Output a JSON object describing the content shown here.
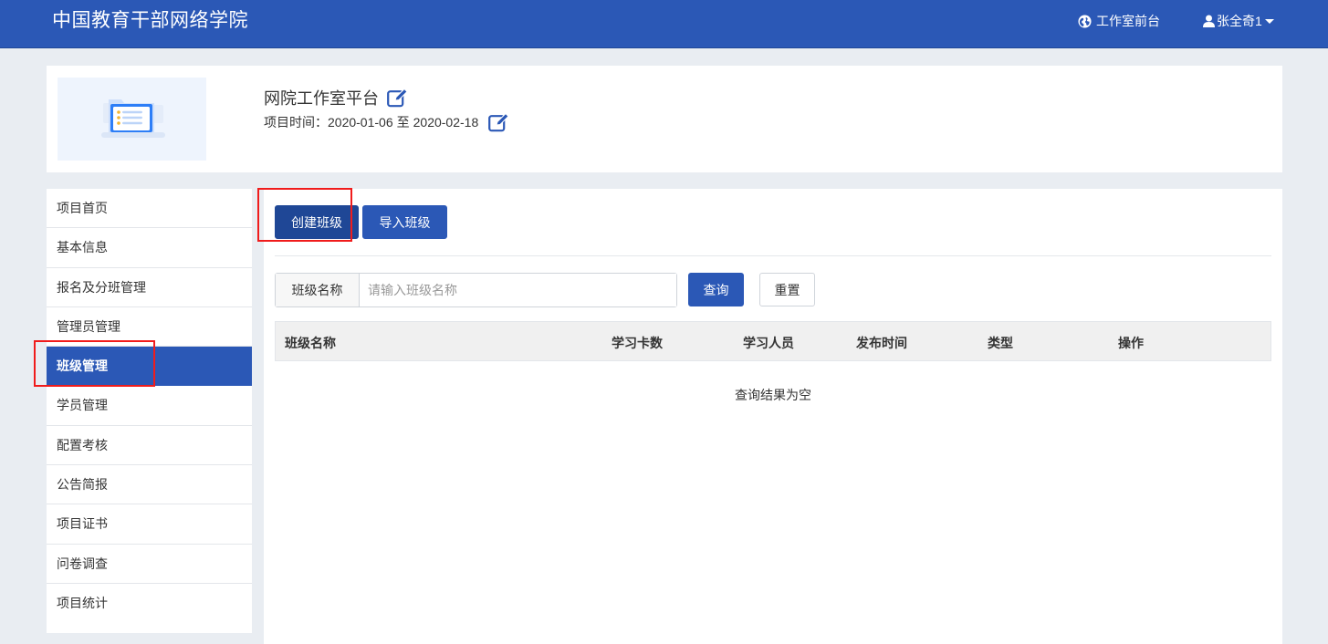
{
  "header": {
    "brand": "中国教育干部网络学院",
    "front_link": "工作室前台",
    "user_name": "张全奇1"
  },
  "project": {
    "title": "网院工作室平台",
    "time_label": "项目时间：",
    "start_date": "2020-01-06",
    "date_separator": "至",
    "end_date": "2020-02-18"
  },
  "sidebar": {
    "items": [
      {
        "label": "项目首页"
      },
      {
        "label": "基本信息"
      },
      {
        "label": "报名及分班管理"
      },
      {
        "label": "管理员管理"
      },
      {
        "label": "班级管理"
      },
      {
        "label": "学员管理"
      },
      {
        "label": "配置考核"
      },
      {
        "label": "公告简报"
      },
      {
        "label": "项目证书"
      },
      {
        "label": "问卷调查"
      },
      {
        "label": "项目统计"
      }
    ],
    "active_index": 4
  },
  "toolbar": {
    "create_label": "创建班级",
    "import_label": "导入班级"
  },
  "search": {
    "label": "班级名称",
    "placeholder": "请输入班级名称",
    "value": "",
    "query_label": "查询",
    "reset_label": "重置"
  },
  "table": {
    "columns": [
      "班级名称",
      "学习卡数",
      "学习人员",
      "发布时间",
      "类型",
      "操作"
    ],
    "rows": [],
    "empty_text": "查询结果为空"
  },
  "colors": {
    "primary": "#2b58b6",
    "highlight": "#f01c1c"
  }
}
